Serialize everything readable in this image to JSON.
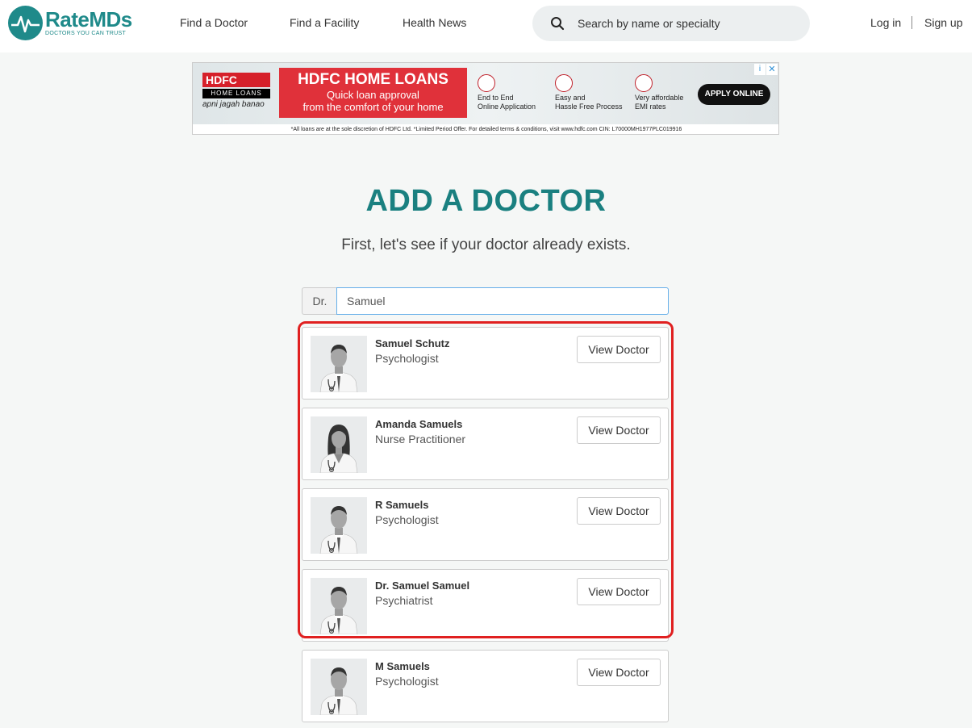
{
  "header": {
    "logo_text": "RateMDs",
    "logo_tagline": "DOCTORS YOU CAN TRUST",
    "nav": [
      {
        "label": "Find a Doctor"
      },
      {
        "label": "Find a Facility"
      },
      {
        "label": "Health News"
      }
    ],
    "search_placeholder": "Search by name or specialty",
    "login_label": "Log in",
    "signup_label": "Sign up"
  },
  "ad": {
    "brand": "HDFC",
    "brand_sub": "HOME LOANS",
    "brand_tag": "apni jagah banao",
    "headline": "HDFC HOME LOANS",
    "sub1": "Quick loan approval",
    "sub2": "from the comfort of your home",
    "features": [
      {
        "line1": "End to End",
        "line2": "Online Application"
      },
      {
        "line1": "Easy and",
        "line2": "Hassle Free Process"
      },
      {
        "line1": "Very affordable",
        "line2": "EMI rates"
      }
    ],
    "cta": "APPLY ONLINE",
    "footer": "*All loans are at the sole discretion of HDFC Ltd. *Limited Period Offer. For detailed terms & conditions, visit www.hdfc.com   CIN: L70000MH1977PLC019916",
    "info_icon": "i",
    "close_icon": "✕"
  },
  "page": {
    "title": "ADD A DOCTOR",
    "subtitle": "First, let's see if your doctor already exists.",
    "prefix": "Dr.",
    "name_value": "Samuel"
  },
  "results": [
    {
      "name": "Samuel Schutz",
      "specialty": "Psychologist",
      "gender": "male",
      "button": "View Doctor"
    },
    {
      "name": "Amanda Samuels",
      "specialty": "Nurse Practitioner",
      "gender": "female",
      "button": "View Doctor"
    },
    {
      "name": "R Samuels",
      "specialty": "Psychologist",
      "gender": "male",
      "button": "View Doctor"
    },
    {
      "name": "Dr. Samuel Samuel",
      "specialty": "Psychiatrist",
      "gender": "male",
      "button": "View Doctor"
    },
    {
      "name": "M Samuels",
      "specialty": "Psychologist",
      "gender": "male",
      "button": "View Doctor"
    }
  ],
  "colors": {
    "brand": "#1f8a8a",
    "title": "#1a8080",
    "highlight": "#e02020"
  }
}
